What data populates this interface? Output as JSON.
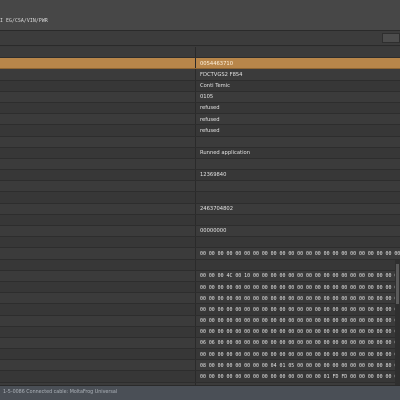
{
  "titlebar": {
    "path": "I EG/CSA/VIN/PWR"
  },
  "rows": [
    {
      "value": "",
      "hex": false
    },
    {
      "value": "0054463710",
      "hex": false,
      "selected": true
    },
    {
      "value": "FDCTVGS2 F854",
      "hex": false
    },
    {
      "value": "Conti Temic",
      "hex": false
    },
    {
      "value": "0105",
      "hex": false
    },
    {
      "value": "refused",
      "hex": false
    },
    {
      "value": "refused",
      "hex": false
    },
    {
      "value": "refused",
      "hex": false
    },
    {
      "value": "",
      "hex": false
    },
    {
      "value": "Runned application",
      "hex": false
    },
    {
      "value": "",
      "hex": false
    },
    {
      "value": "12369840",
      "hex": false
    },
    {
      "value": "",
      "hex": false
    },
    {
      "value": "",
      "hex": false
    },
    {
      "value": "2463704802",
      "hex": false
    },
    {
      "value": "",
      "hex": false
    },
    {
      "value": "00000000",
      "hex": false
    },
    {
      "value": "",
      "hex": false
    },
    {
      "value": "00 00 00 00 00 00 00 00 00 00 00 00 00 00 00 00 00 00 00 00 00 00 00 00 00 00 00 00",
      "hex": true
    },
    {
      "value": "",
      "hex": false
    },
    {
      "value": "00 00 00 4C 00 10 00 00 00 00 00 00 00 00 00 00 00 00 00 00 00 00 00 00 00 00 00 00",
      "hex": true
    },
    {
      "value": "00 00 00 00 00 00 00 00 00 00 00 00 00 00 00 00 00 00 00 00 00 00 00 00 00 00 00 00",
      "hex": true
    },
    {
      "value": "00 00 00 00 00 00 00 00 00 00 00 00 00 00 00 00 00 00 00 00 00 00 00 00 00 00 00 00",
      "hex": true
    },
    {
      "value": "00 00 00 00 00 00 00 00 00 00 00 00 00 00 00 00 00 00 00 00 00 00 00 00 00 00 00 00",
      "hex": true
    },
    {
      "value": "00 00 00 00 00 00 00 00 00 00 00 00 00 00 00 00 00 00 00 00 00 00 00 00 00 00 00 00",
      "hex": true
    },
    {
      "value": "00 00 00 00 00 00 00 00 00 00 00 00 00 00 00 00 00 00 00 00 00 00 00 00 00 00 00 00",
      "hex": true
    },
    {
      "value": "06 06 00 00 00 00 00 00 00 00 00 00 00 00 00 00 00 00 00 00 00 00 00 00 00 00 00 00",
      "hex": true
    },
    {
      "value": "00 00 00 00 00 00 00 00 00 00 00 00 00 00 00 00 00 00 00 00 00 00 00 00 00 00 00 00",
      "hex": true
    },
    {
      "value": "08 00 00 00 00 00 00 00 04 01 05 00 00 00 00 00 00 00 00 00 00 80 00 80 80 80 80 80",
      "hex": true
    },
    {
      "value": "00 00 00 00 00 00 00 00 00 00 00 00 00 00 01 FD FD 00 00 00 00 00 00 00 00 00 00 00",
      "hex": true
    },
    {
      "value": "00 00 00 00 00 00 00 00 00 00 00 70 70 70 70 70 70 70 70 70 70 70 70 70 70 70 70 70",
      "hex": true
    }
  ],
  "statusbar": {
    "text": "1-5-0086   Connected cable: MoltaFrog Universal"
  }
}
